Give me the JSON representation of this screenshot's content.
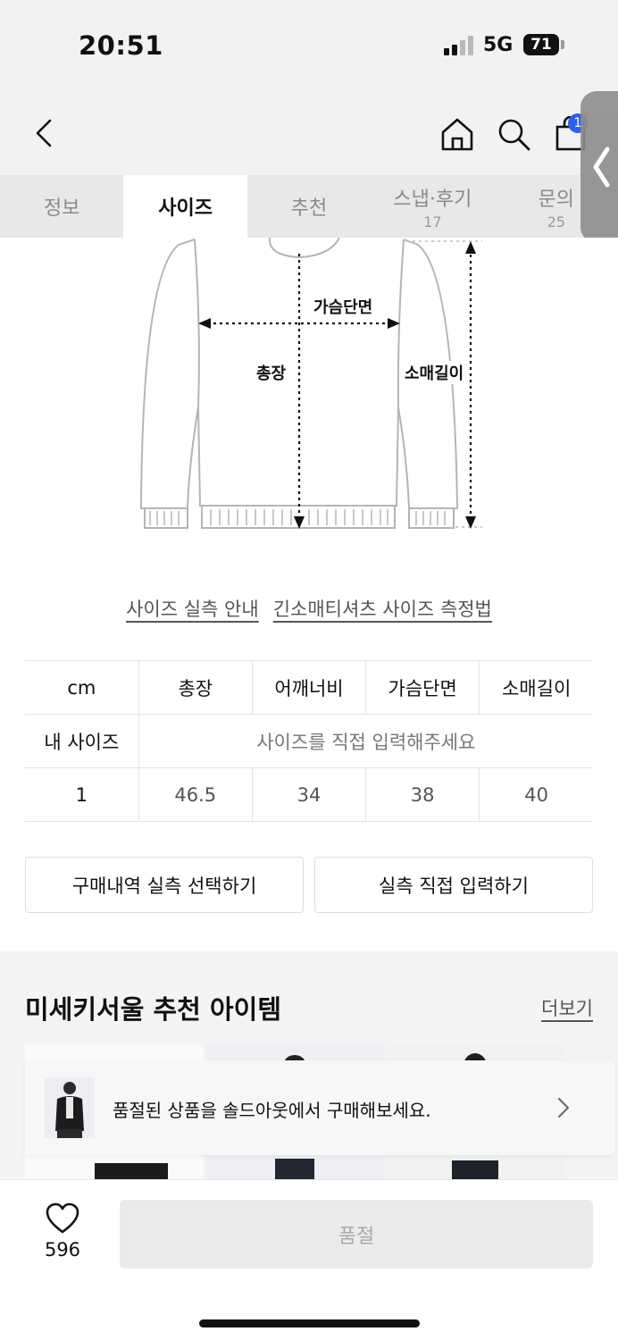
{
  "status_bar": {
    "time": "20:51",
    "network": "5G",
    "battery": "71"
  },
  "header": {
    "cart_count": "1"
  },
  "tabs": [
    {
      "label": "정보",
      "count": ""
    },
    {
      "label": "사이즈",
      "count": ""
    },
    {
      "label": "추천",
      "count": ""
    },
    {
      "label": "스냅·후기",
      "count": "17"
    },
    {
      "label": "문의",
      "count": "25"
    }
  ],
  "active_tab": "사이즈",
  "diagram": {
    "chest_label": "가슴단면",
    "length_label": "총장",
    "sleeve_label": "소매길이"
  },
  "guides": {
    "size_guide": "사이즈 실측 안내",
    "measure_guide": "긴소매티셔츠 사이즈 측정법"
  },
  "size_table": {
    "unit": "cm",
    "headers": [
      "총장",
      "어깨너비",
      "가슴단면",
      "소매길이"
    ],
    "my_size_label": "내 사이즈",
    "my_size_placeholder": "사이즈를 직접 입력해주세요",
    "rows": [
      {
        "size": "1",
        "values": [
          "46.5",
          "34",
          "38",
          "40"
        ]
      }
    ]
  },
  "actions": {
    "select_history": "구매내역 실측 선택하기",
    "direct_input": "실측 직접 입력하기"
  },
  "recommend": {
    "title": "미세키서울 추천 아이템",
    "more": "더보기",
    "banner_text": "품절된 상품을 솔드아웃에서 구매해보세요."
  },
  "bottom_bar": {
    "likes": "596",
    "buy_button": "품절"
  },
  "colors": {
    "accent_badge": "#2f5fe8",
    "soldout_button_bg": "#ebebeb"
  }
}
